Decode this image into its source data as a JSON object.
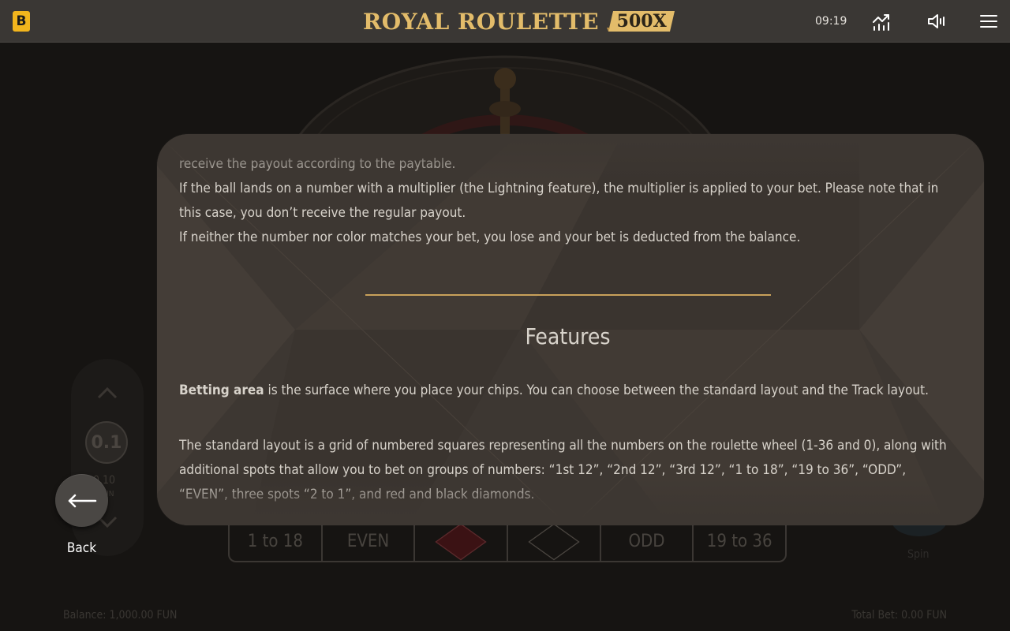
{
  "header": {
    "brand_badge": "B",
    "logo_text": "ROYAL ROULETTE",
    "logo_badge": "500X",
    "clock": "09:19",
    "icons": [
      "stats-icon",
      "sound-icon",
      "menu-icon"
    ]
  },
  "background": {
    "bet_cells": [
      "1 to 18",
      "EVEN",
      "",
      "",
      "ODD",
      "19 to 36"
    ],
    "chip_value": "0.1",
    "bet_amount": "0.10",
    "bet_unit": "FUN",
    "spin_label": "Spin",
    "balance": "Balance: 1,000.00 FUN",
    "total_bet": "Total Bet: 0.00 FUN"
  },
  "rules": {
    "p_prev_tail": "receive the payout according to the paytable.",
    "p_multiplier": "If the ball lands on a number with a multiplier (the Lightning feature), the multiplier is applied to your bet. Please note that in this case, you don’t receive the regular payout.",
    "p_lose": "If neither the number nor color matches your bet, you lose and your bet is deducted from the balance.",
    "features_title": "Features",
    "betting_area_term": "Betting area",
    "betting_area_desc": " is the surface where you place your chips. You can choose between the standard layout and the Track layout.",
    "standard_layout": "The standard layout is a grid of numbered squares representing all the numbers on the roulette wheel (1-36 and 0), along with additional spots that allow you to bet on groups of numbers: “1st 12”, “2nd 12”, “3rd 12”, “1 to 18”, “19 to 36”, “ODD”, “EVEN”, three spots “2 to 1”, and red and black diamonds."
  },
  "back": {
    "label": "Back"
  },
  "colors": {
    "accent": "#e3bc6a",
    "brand": "#f2b51d",
    "modal_bg": "#3d3732"
  }
}
